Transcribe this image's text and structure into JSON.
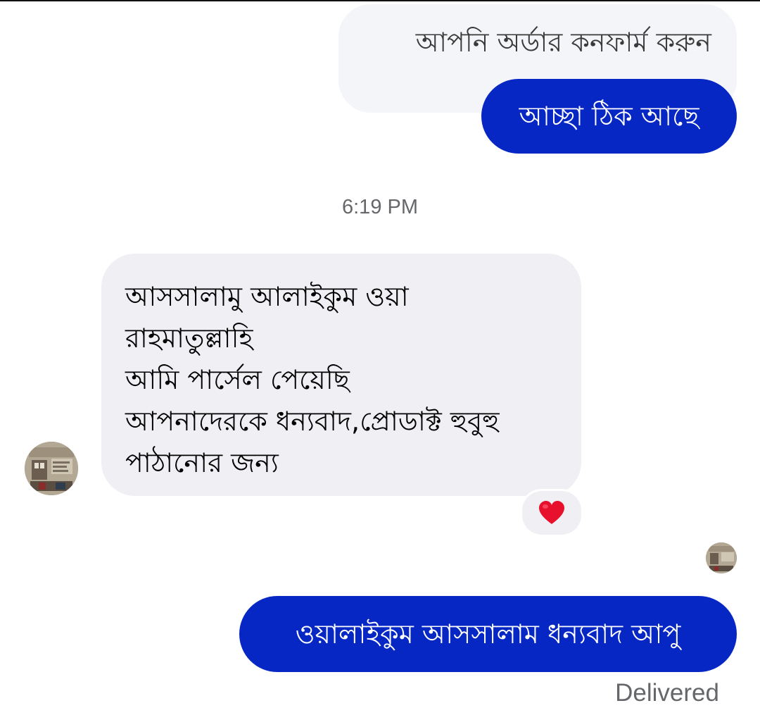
{
  "messages": [
    {
      "sender": "contact",
      "text": "আপনি অর্ডার কনফার্ম করুন"
    },
    {
      "sender": "me",
      "text": "আচ্ছা ঠিক আছে"
    },
    {
      "sender": "contact",
      "lines": [
        "আসসালামু আলাইকুম ওয়া",
        "রাহমাতুল্লাহি",
        "আমি পার্সেল পেয়েছি",
        "আপনাদেরকে ধন্যবাদ,প্রোডাক্ট হুবুহু",
        "পাঠানোর জন্য"
      ],
      "reaction": "heart-icon"
    },
    {
      "sender": "me",
      "text": "ওয়ালাইকুম আসসালাম ধন্যবাদ আপু"
    }
  ],
  "timestamp": "6:19 PM",
  "delivery_status": "Delivered",
  "colors": {
    "outgoing_bubble": "#0727c4",
    "incoming_bubble": "#f0f0f4",
    "meta_text": "#65676b",
    "reaction_heart": "#e8112d"
  }
}
